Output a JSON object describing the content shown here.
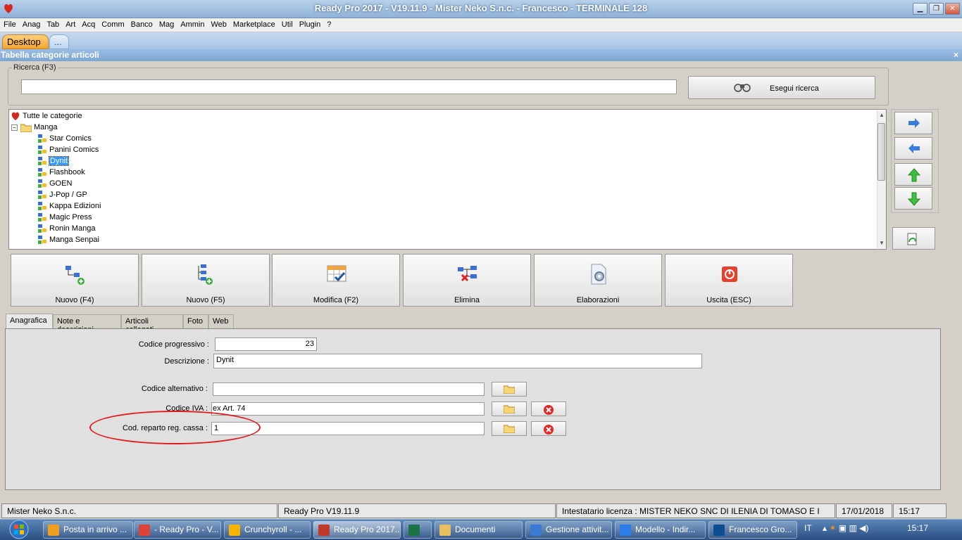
{
  "window": {
    "title": "Ready Pro 2017 - V19.11.9 - Mister Neko S.n.c. - Francesco - TERMINALE 128"
  },
  "menu": [
    "File",
    "Anag",
    "Tab",
    "Art",
    "Acq",
    "Comm",
    "Banco",
    "Mag",
    "Ammin",
    "Web",
    "Marketplace",
    "Util",
    "Plugin",
    "?"
  ],
  "app_tabs": {
    "desktop": "Desktop",
    "more": "..."
  },
  "panel": {
    "title": "Tabella categorie articoli",
    "close": "×"
  },
  "search": {
    "legend": "Ricerca (F3)",
    "value": "",
    "button": "Esegui ricerca"
  },
  "tree": {
    "root": "Tutte le categorie",
    "folder": "Manga",
    "items": [
      "Star Comics",
      "Panini Comics",
      "Dynit",
      "Flashbook",
      "GOEN",
      "J-Pop / GP",
      "Kappa Edizioni",
      "Magic Press",
      "Ronin Manga",
      "Manga Senpai"
    ],
    "selected": "Dynit"
  },
  "actions": [
    {
      "label": "Nuovo (F4)",
      "icon": "new-node-icon"
    },
    {
      "label": "Nuovo (F5)",
      "icon": "new-child-icon"
    },
    {
      "label": "Modifica (F2)",
      "icon": "edit-grid-icon"
    },
    {
      "label": "Elimina",
      "icon": "delete-node-icon"
    },
    {
      "label": "Elaborazioni",
      "icon": "process-gear-icon"
    },
    {
      "label": "Uscita (ESC)",
      "icon": "power-icon"
    }
  ],
  "subtabs": [
    "Anagrafica",
    "Note e descrizioni",
    "Articoli collegati",
    "Foto",
    "Web"
  ],
  "form": {
    "codice_progressivo": {
      "label": "Codice progressivo :",
      "value": "23"
    },
    "descrizione": {
      "label": "Descrizione :",
      "value": "Dynit"
    },
    "codice_alternativo": {
      "label": "Codice alternativo :",
      "value": ""
    },
    "codice_iva": {
      "label": "Codice IVA :",
      "value": "ex Art. 74"
    },
    "cod_reparto": {
      "label": "Cod. reparto reg. cassa :",
      "value": "1"
    }
  },
  "status": {
    "company": "Mister Neko S.n.c.",
    "version": "Ready Pro V19.11.9",
    "license": "Intestatario licenza : MISTER NEKO SNC DI ILENIA DI TOMASO E I",
    "date": "17/01/2018",
    "time": "15:17"
  },
  "taskbar": {
    "items": [
      {
        "label": "Posta in arrivo ...",
        "color": "#f0a020"
      },
      {
        "label": "- Ready Pro - V...",
        "color": "#db4437"
      },
      {
        "label": "Crunchyroll - ...",
        "color": "#f4b400"
      },
      {
        "label": "Ready Pro 2017...",
        "color": "#c0392b"
      },
      {
        "label": "",
        "color": "#1e7145"
      },
      {
        "label": "Documenti",
        "color": "#e8c060"
      },
      {
        "label": "Gestione attivit...",
        "color": "#3a7bd5"
      },
      {
        "label": "Modello - Indir...",
        "color": "#2b7de9"
      },
      {
        "label": "Francesco Gro...",
        "color": "#0e4d92"
      }
    ],
    "lang": "IT",
    "clock": "15:17"
  }
}
